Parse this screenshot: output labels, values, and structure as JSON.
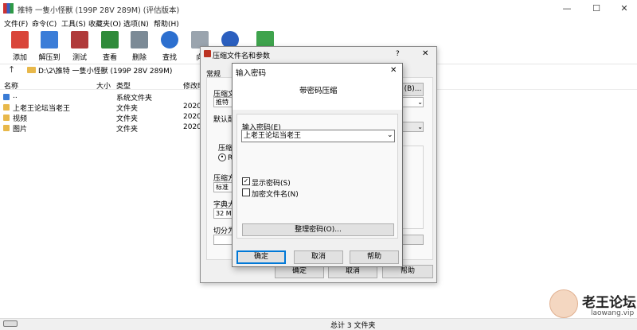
{
  "window": {
    "title": "推特 一隻小怪獸 (199P 28V 289M) (评估版本)",
    "minimize": "—",
    "maximize": "☐",
    "close": "✕"
  },
  "menu": [
    "文件(F)",
    "命令(C)",
    "工具(S)",
    "收藏夹(O)",
    "选项(N)",
    "帮助(H)"
  ],
  "toolbar": [
    {
      "label": "添加",
      "color": "#d9453a"
    },
    {
      "label": "解压到",
      "color": "#3b7dd8"
    },
    {
      "label": "测试",
      "color": "#b03a3a"
    },
    {
      "label": "查看",
      "color": "#2f8b3a"
    },
    {
      "label": "删除",
      "color": "#7b8a96"
    },
    {
      "label": "查找",
      "color": "#2c6fcf"
    },
    {
      "label": "向",
      "color": "#9aa4ae"
    },
    {
      "label": "",
      "color": "#2b5fbf"
    },
    {
      "label": "",
      "color": "#3fa34d"
    }
  ],
  "address": {
    "up": "↑",
    "path": "D:\\2\\推特 一隻小怪獸 (199P 28V 289M)"
  },
  "columns": {
    "name": "名称",
    "size": "大小",
    "type": "类型",
    "modified": "修改时"
  },
  "files": [
    {
      "name": "..",
      "type": "系统文件夹",
      "date": ""
    },
    {
      "name": "上老王论坛当老王",
      "type": "文件夹",
      "date": "2020"
    },
    {
      "name": "视频",
      "type": "文件夹",
      "date": "2020"
    },
    {
      "name": "图片",
      "type": "文件夹",
      "date": "2020"
    }
  ],
  "status": {
    "text": "总计 3 文件夹"
  },
  "watermark": {
    "title": "老王论坛",
    "url": "laowang.vip"
  },
  "dialog1": {
    "title": "压缩文件名和参数",
    "help": "?",
    "close": "✕",
    "tab": "常规",
    "label_archive": "压缩文",
    "archive_value": "推特",
    "browse": "(B)...",
    "label_profile": "默认配",
    "label_format": "压缩",
    "format_radio": "Ra",
    "label_method": "压缩方",
    "method_value": "标准",
    "label_dict": "字典大",
    "dict_value": "32 MB",
    "label_split": "切分为",
    "ok": "确定",
    "cancel": "取消",
    "help_btn": "帮助"
  },
  "dialog2": {
    "title": "输入密码",
    "close": "✕",
    "header": "带密码压缩",
    "label": "输入密码(E)",
    "value": "上老王论坛当老王",
    "show_password": "显示密码(S)",
    "encrypt_names": "加密文件名(N)",
    "organize": "整理密码(O)...",
    "ok": "确定",
    "cancel": "取消",
    "help": "帮助"
  }
}
